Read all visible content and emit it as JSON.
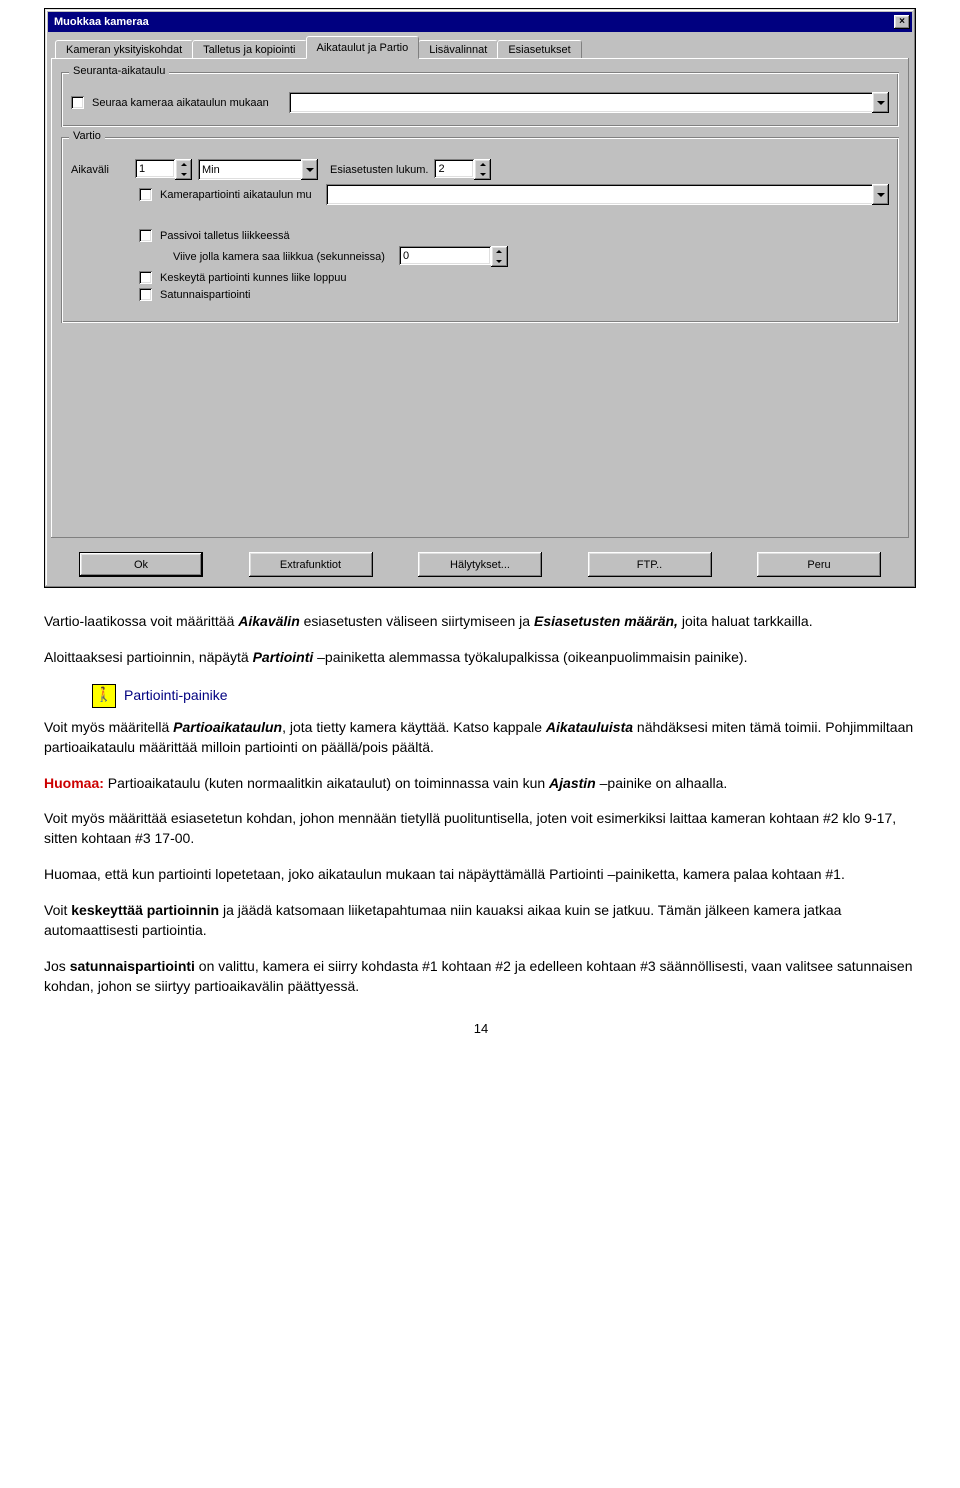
{
  "dialog": {
    "title": "Muokkaa kameraa",
    "close_glyph": "×",
    "tabs": [
      "Kameran yksityiskohdat",
      "Talletus ja kopiointi",
      "Aikataulut ja Partio",
      "Lisävalinnat",
      "Esiasetukset"
    ],
    "active_tab": 2,
    "group_tracking": {
      "title": "Seuranta-aikataulu",
      "follow_schedule": "Seuraa kameraa aikataulun mukaan"
    },
    "group_patrol": {
      "title": "Vartio",
      "interval_label": "Aikaväli",
      "interval_value": "1",
      "unit_selected": "Min",
      "preset_count_label": "Esiasetusten lukum.",
      "preset_count_value": "2",
      "patrol_schedule_label": "Kamerapartiointi aikataulun mu",
      "passivate_label": "Passivoi talletus liikkeessä",
      "delay_label": "Viive jolla kamera saa liikkua (sekunneissa)",
      "delay_value": "0",
      "pause_label": "Keskeytä partiointi kunnes liike loppuu",
      "random_label": "Satunnaispartiointi"
    },
    "buttons": {
      "ok": "Ok",
      "extra": "Extrafunktiot",
      "alerts": "Hälytykset...",
      "ftp": "FTP..",
      "cancel": "Peru"
    }
  },
  "doc": {
    "p1_a": "Vartio-laatikossa voit määrittää ",
    "p1_aikavalin": "Aikavälin",
    "p1_b": " esiasetusten väliseen siirtymiseen ja ",
    "p1_esias": "Esiasetusten määrän,",
    "p1_c": " joita haluat tarkkailla.",
    "p2_a": "Aloittaaksesi partioinnin, näpäytä ",
    "p2_part": "Partiointi",
    "p2_b": " –painiketta alemmassa työkalupalkissa (oikeanpuolimmaisin painike).",
    "icon_caption": "Partiointi-painike",
    "p3_a": "Voit myös määritellä ",
    "p3_part": "Partioaikataulun",
    "p3_b": ", jota tietty kamera käyttää. Katso kappale ",
    "p3_aik": "Aikatauluista",
    "p3_c": " nähdäksesi miten tämä toimii. Pohjimmiltaan partioaikataulu määrittää milloin partiointi on päällä/pois päältä.",
    "p4_a": "Huomaa:",
    "p4_b": " Partioaikataulu (kuten normaalitkin aikataulut) on toiminnassa vain kun ",
    "p4_ajastin": "Ajastin",
    "p4_c": " –painike on alhaalla.",
    "p5": "Voit myös määrittää esiasetetun kohdan, johon mennään tietyllä puolituntisella, joten voit esimerkiksi laittaa kameran kohtaan #2 klo 9-17, sitten kohtaan #3 17-00.",
    "p6": "Huomaa, että kun partiointi lopetetaan, joko aikataulun mukaan tai näpäyttämällä Partiointi –painiketta, kamera palaa kohtaan #1.",
    "p7_a": "Voit ",
    "p7_b": "keskeyttää partioinnin",
    "p7_c": " ja jäädä katsomaan liiketapahtumaa niin kauaksi aikaa kuin se jatkuu. Tämän jälkeen kamera jatkaa automaattisesti partiointia.",
    "p8_a": "Jos ",
    "p8_b": "satunnaispartiointi",
    "p8_c": " on valittu, kamera ei siirry kohdasta #1 kohtaan #2 ja edelleen kohtaan #3 säännöllisesti, vaan valitsee satunnaisen kohdan, johon se siirtyy partioaikavälin päättyessä.",
    "pagenum": "14"
  }
}
